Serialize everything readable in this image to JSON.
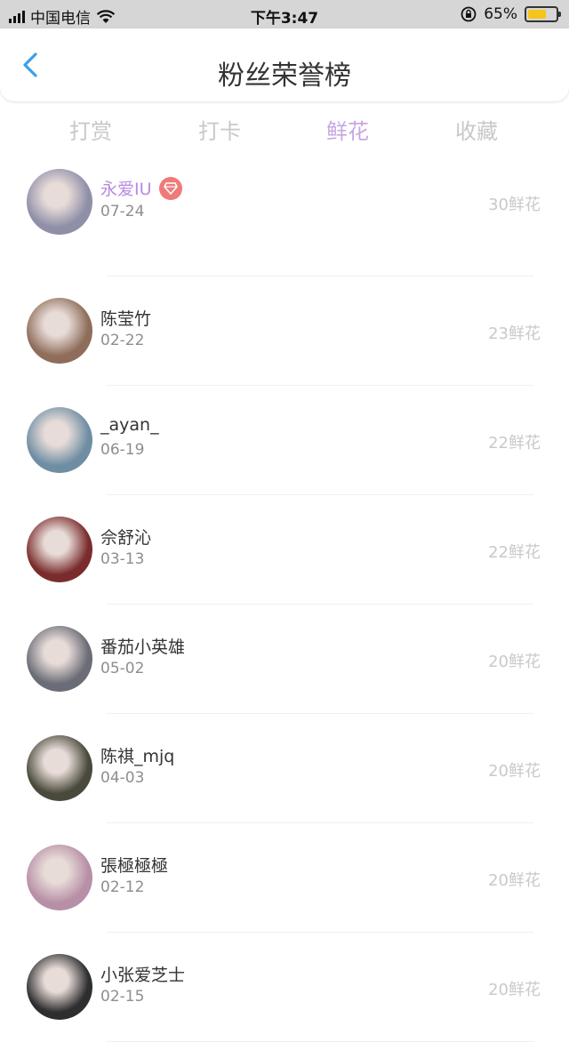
{
  "status_bar": {
    "carrier": "中国电信",
    "time": "下午3:47",
    "battery_percent_text": "65%",
    "battery_level": 0.65
  },
  "header": {
    "title": "粉丝荣誉榜",
    "back_icon": "chevron-left-icon"
  },
  "tabs": [
    {
      "label": "打赏",
      "active": false
    },
    {
      "label": "打卡",
      "active": false
    },
    {
      "label": "鲜花",
      "active": true
    },
    {
      "label": "收藏",
      "active": false
    }
  ],
  "colors": {
    "accent": "#c9a6e2",
    "highlight_name": "#b88be0",
    "badge": "#f07a7a",
    "back_arrow": "#3aa0e8"
  },
  "fans": [
    {
      "name": "永爱IU",
      "date": "07-24",
      "count": "30鲜花",
      "highlight": true,
      "badge": "diamond-icon",
      "avatar_color": "#8f8fa8"
    },
    {
      "name": "陈莹竹",
      "date": "02-22",
      "count": "23鲜花",
      "highlight": false,
      "avatar_color": "#8e6d5a"
    },
    {
      "name": "_ayan_",
      "date": "06-19",
      "count": "22鲜花",
      "highlight": false,
      "avatar_color": "#6f8ea4"
    },
    {
      "name": "佘舒沁",
      "date": "03-13",
      "count": "22鲜花",
      "highlight": false,
      "avatar_color": "#7a2c2c"
    },
    {
      "name": "番茄小英雄",
      "date": "05-02",
      "count": "20鲜花",
      "highlight": false,
      "avatar_color": "#6a6c76"
    },
    {
      "name": "陈祺_mjq",
      "date": "04-03",
      "count": "20鲜花",
      "highlight": false,
      "avatar_color": "#4a4a3c"
    },
    {
      "name": "張極極極",
      "date": "02-12",
      "count": "20鲜花",
      "highlight": false,
      "avatar_color": "#b78fa6"
    },
    {
      "name": "小张爱芝士",
      "date": "02-15",
      "count": "20鲜花",
      "highlight": false,
      "avatar_color": "#2e2e30"
    }
  ]
}
